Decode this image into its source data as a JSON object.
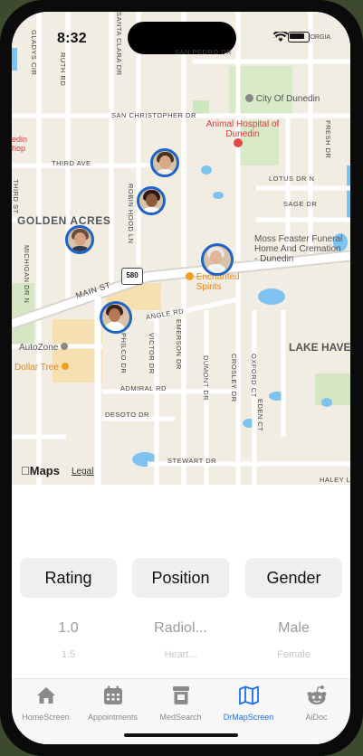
{
  "status_bar": {
    "time": "8:32",
    "carrier_fragment": "ORGIA"
  },
  "map": {
    "places": {
      "city": "City Of Dunedin",
      "animal_hospital": "Animal Hospital of Dunedin",
      "edin_fragment": "edin",
      "hop_fragment": "hop",
      "golden_acres": "GOLDEN ACRES",
      "funeral": "Moss Feaster Funeral Home And Cremation - Dunedin",
      "enchanted": "Enchanted Spirits",
      "lake_haven": "LAKE HAVE",
      "autozone": "AutoZone",
      "dollar_tree": "Dollar Tree"
    },
    "roads": {
      "glladys": "GLADYS CIR",
      "ruth": "RUTH RD",
      "santa_clara": "SANTA CLARA DR",
      "pedro": "SAN PEDRO DR",
      "christopher": "SAN CHRISTOPHER DR",
      "third_ave": "THIRD AVE",
      "third_st": "THIRD ST",
      "robin_hood": "ROBIN HOOD LN",
      "lotus": "LOTUS DR N",
      "sage": "SAGE DR",
      "michigan": "MICHIGAN DR N",
      "main_st": "MAIN ST",
      "angle": "ANGLE RD",
      "philco": "PHILCO DR",
      "victor": "VICTOR DR",
      "emerson": "EMERSON DR",
      "dumont": "DUMONT DR",
      "crosley": "CROSLEY DR",
      "oxford": "OXFORD CT",
      "admiral": "ADMIRAL RD",
      "desoto": "DESOTO DR",
      "eden": "EDEN CT",
      "stewart": "STEWART DR",
      "haley": "HALEY L",
      "fresh": "FRESH DR"
    },
    "route_shield": "580",
    "attribution": {
      "brand": "Maps",
      "legal": "Legal"
    },
    "pins": [
      {
        "name": "doctor-pin-1",
        "hair": "#4a3222",
        "face": "#d8a987",
        "body": "#f2f2f2"
      },
      {
        "name": "doctor-pin-2",
        "hair": "#2b1a12",
        "face": "#8c5a3c",
        "body": "#ffffff"
      },
      {
        "name": "doctor-pin-3",
        "hair": "#6b4d3a",
        "face": "#d4a285",
        "body": "#2f3a4a"
      },
      {
        "name": "doctor-pin-4",
        "hair": "#e8e8e8",
        "face": "#e0b59a",
        "body": "#f3f3f3"
      },
      {
        "name": "doctor-pin-5",
        "hair": "#3a2418",
        "face": "#b57a55",
        "body": "#ffffff"
      }
    ],
    "pin_border_color": "#1e63c6"
  },
  "pickers": [
    {
      "label": "Rating",
      "selected": "1.0",
      "next": "1.5"
    },
    {
      "label": "Position",
      "selected": "Radiol...",
      "next": "Heart..."
    },
    {
      "label": "Gender",
      "selected": "Male",
      "next": "Female"
    }
  ],
  "tabbar": {
    "active_color": "#1e6ef5",
    "tabs": [
      {
        "label": "HomeScreen",
        "icon": "house-icon"
      },
      {
        "label": "Appointments",
        "icon": "calendar-icon"
      },
      {
        "label": "MedSearch",
        "icon": "pill-bottle-icon"
      },
      {
        "label": "DrMapScreen",
        "icon": "map-icon"
      },
      {
        "label": "AiDoc",
        "icon": "reddit-robot-icon"
      }
    ]
  }
}
